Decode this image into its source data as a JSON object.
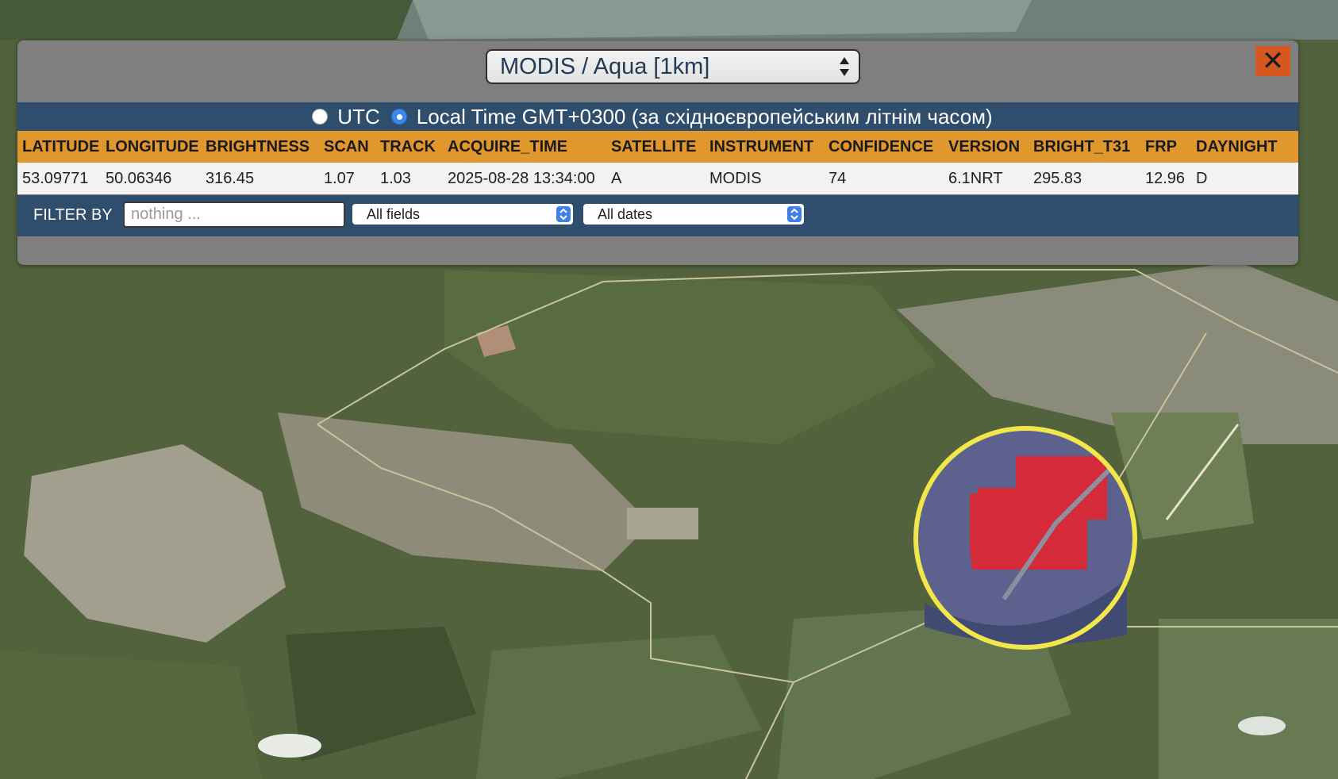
{
  "satellite_select": {
    "value": "MODIS / Aqua [1km]"
  },
  "close_button": {
    "label": "✕"
  },
  "time_mode": {
    "options": [
      {
        "label": "UTC",
        "checked": false
      },
      {
        "label": "Local Time GMT+0300 (за східноєвропейським літнім часом)",
        "checked": true
      }
    ]
  },
  "table": {
    "headers": [
      "LATITUDE",
      "LONGITUDE",
      "BRIGHTNESS",
      "SCAN",
      "TRACK",
      "ACQUIRE_TIME",
      "SATELLITE",
      "INSTRUMENT",
      "CONFIDENCE",
      "VERSION",
      "BRIGHT_T31",
      "FRP",
      "DAYNIGHT"
    ],
    "rows": [
      [
        "53.09771",
        "50.06346",
        "316.45",
        "1.07",
        "1.03",
        "2025-08-28 13:34:00",
        "A",
        "MODIS",
        "74",
        "6.1NRT",
        "295.83",
        "12.96",
        "D"
      ]
    ]
  },
  "filter": {
    "label": "FILTER BY",
    "input_placeholder": "nothing ...",
    "input_value": "",
    "field_select": "All fields",
    "date_select": "All dates"
  },
  "map": {
    "highlight_ring_color": "#f2e64a",
    "fire_area_color": "#d42a3a"
  }
}
